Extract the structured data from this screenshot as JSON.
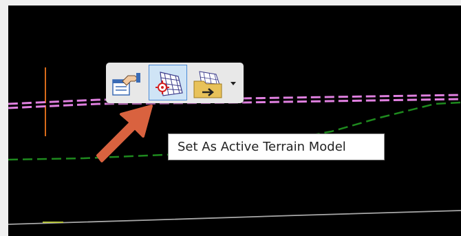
{
  "toolbar": {
    "buttons": [
      {
        "id": "properties",
        "icon": "properties-hand-icon"
      },
      {
        "id": "set-active-terrain",
        "icon": "terrain-mesh-target-icon",
        "active": true
      },
      {
        "id": "export-terrain",
        "icon": "terrain-folder-export-icon"
      }
    ],
    "dropdown_icon": "chevron-down-icon"
  },
  "tooltip": {
    "text": "Set As Active Terrain Model"
  },
  "annotation": {
    "arrow_color": "#d9623f"
  },
  "colors": {
    "canvas_bg": "#000000",
    "pink_dashed": "#e080e0",
    "green_dashed": "#1e8a1e",
    "orange_line": "#d86b1a",
    "active_highlight": "#cfe4f6"
  }
}
